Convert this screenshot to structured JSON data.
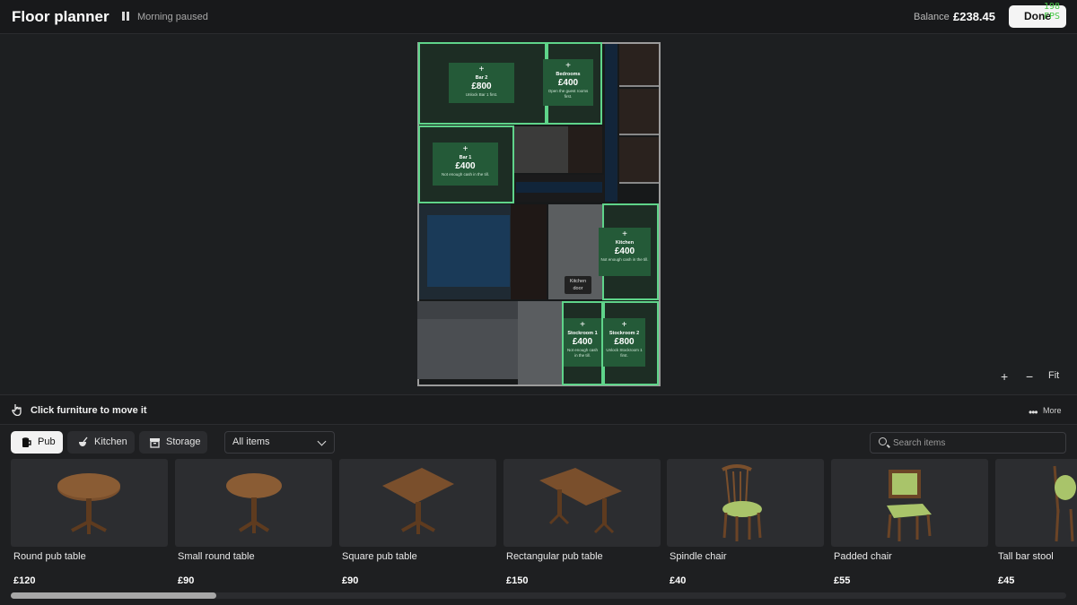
{
  "header": {
    "title": "Floor planner",
    "status": "Morning paused",
    "balance_label": "Balance",
    "balance_value": "£238.45",
    "done_label": "Done",
    "fps": "198 FPS"
  },
  "plan": {
    "zones": [
      {
        "name": "Bar 2",
        "price": "£800",
        "note": "Unlock Bar 1 first."
      },
      {
        "name": "Bedrooms",
        "price": "£400",
        "note": "Open the guest rooms first."
      },
      {
        "name": "Bar 1",
        "price": "£400",
        "note": "Not enough cash in the till."
      },
      {
        "name": "Kitchen",
        "price": "£400",
        "note": "Not enough cash in the till."
      },
      {
        "name": "Stockroom 1",
        "price": "£400",
        "note": "Not enough cash in the till."
      },
      {
        "name": "Stockroom 2",
        "price": "£800",
        "note": "Unlock Stockroom 1 first."
      }
    ],
    "kitchen_door": "Kitchen door",
    "zoom_in": "+",
    "zoom_out": "−",
    "fit": "Fit"
  },
  "hint": {
    "text": "Click furniture to move it",
    "more_label": "More",
    "more_icon": "•••"
  },
  "catalog": {
    "tabs": [
      {
        "label": "Pub",
        "icon": "pub-icon"
      },
      {
        "label": "Kitchen",
        "icon": "kitchen-icon"
      },
      {
        "label": "Storage",
        "icon": "storage-icon"
      }
    ],
    "filter_value": "All items",
    "search_placeholder": "Search items",
    "items": [
      {
        "name": "Round pub table",
        "price": "£120"
      },
      {
        "name": "Small round table",
        "price": "£90"
      },
      {
        "name": "Square pub table",
        "price": "£90"
      },
      {
        "name": "Rectangular pub table",
        "price": "£150"
      },
      {
        "name": "Spindle chair",
        "price": "£40"
      },
      {
        "name": "Padded chair",
        "price": "£55"
      },
      {
        "name": "Tall bar stool",
        "price": "£45"
      }
    ]
  }
}
